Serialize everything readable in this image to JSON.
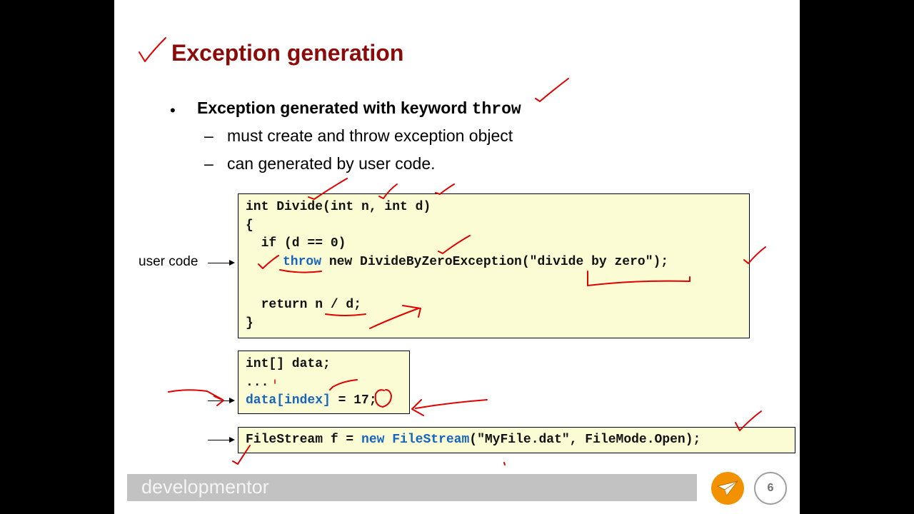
{
  "slide": {
    "title": "Exception generation",
    "bullet": {
      "marker": "•",
      "text": "Exception generated with keyword ",
      "keyword": "throw"
    },
    "subbullets": [
      {
        "dash": "–",
        "text": "must create and throw exception object"
      },
      {
        "dash": "–",
        "text": "can generated by user code."
      }
    ],
    "user_code_label": "user code",
    "code_block_1": {
      "lines": [
        "int Divide(int n, int d)",
        "{",
        "  if (d == 0)",
        "throw",
        " new DivideByZeroException(\"divide by zero\");",
        "  return n / d;",
        "}"
      ]
    },
    "code_block_2": {
      "line1": "int[] data;",
      "line2": "...",
      "line3_blue": "data[index]",
      "line3_rest": " = 17;"
    },
    "code_block_3": {
      "part1": "FileStream f = ",
      "kw_new": "new",
      "space": " ",
      "kw_type": "FileStream",
      "part2": "(\"MyFile.dat\", FileMode.Open);"
    },
    "footer": {
      "brand": "developmentor",
      "page_number": "6"
    }
  },
  "colors": {
    "title": "#8b0a0a",
    "code_background": "#fcfcd4",
    "keyword_blue": "#1565c0",
    "annotation_red": "#e00000",
    "footer_bar": "#c2c2c2",
    "logo_orange": "#f39200"
  }
}
